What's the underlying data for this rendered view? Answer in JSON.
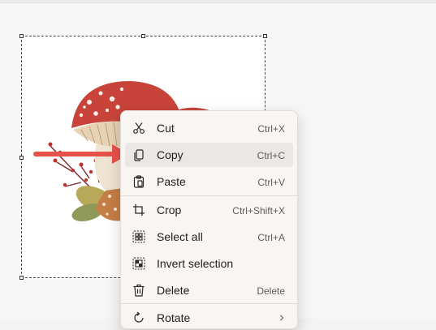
{
  "menu": {
    "items": [
      {
        "label": "Cut",
        "shortcut": "Ctrl+X",
        "icon": "scissors-icon"
      },
      {
        "label": "Copy",
        "shortcut": "Ctrl+C",
        "icon": "copy-icon",
        "hovered": true
      },
      {
        "label": "Paste",
        "shortcut": "Ctrl+V",
        "icon": "paste-icon"
      },
      {
        "label": "Crop",
        "shortcut": "Ctrl+Shift+X",
        "icon": "crop-icon"
      },
      {
        "label": "Select all",
        "shortcut": "Ctrl+A",
        "icon": "select-all-icon"
      },
      {
        "label": "Invert selection",
        "shortcut": "",
        "icon": "invert-selection-icon"
      },
      {
        "label": "Delete",
        "shortcut": "Delete",
        "icon": "trash-icon"
      },
      {
        "label": "Rotate",
        "shortcut": "",
        "icon": "rotate-icon",
        "has_submenu": true
      }
    ]
  },
  "annotation": {
    "arrow_color": "#e8504a",
    "points_to": "Copy"
  },
  "colors": {
    "menu_background": "#f9f5f3",
    "hover_background": "#ebe7e5",
    "mushroom_cap": "#c8443a"
  }
}
